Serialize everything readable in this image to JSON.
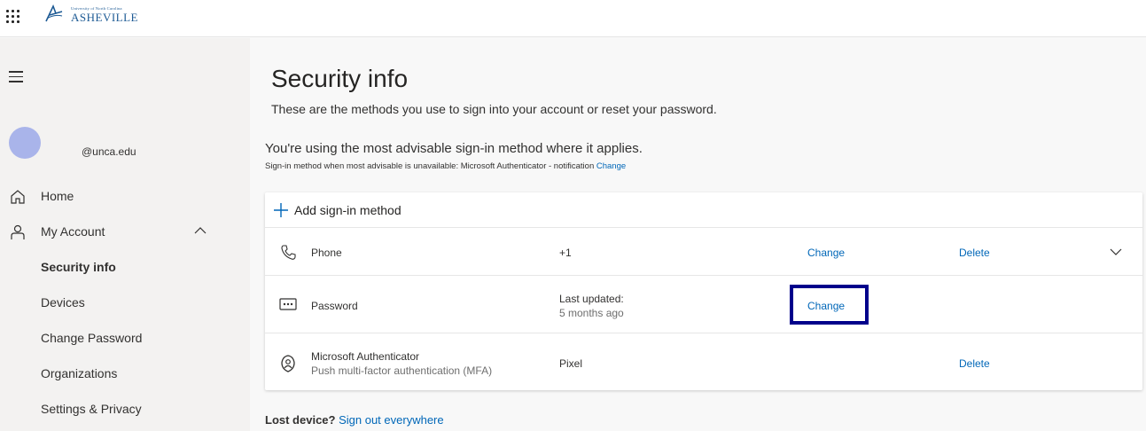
{
  "header": {
    "logo_sub": "University of North Carolina",
    "logo_main": "ASHEVILLE",
    "brand_color": "#1d5a94"
  },
  "sidebar": {
    "email": "@unca.edu",
    "items": [
      {
        "label": "Home",
        "icon": "home-icon"
      },
      {
        "label": "My Account",
        "icon": "person-icon"
      },
      {
        "label": "Security info"
      },
      {
        "label": "Devices"
      },
      {
        "label": "Change Password"
      },
      {
        "label": "Organizations"
      },
      {
        "label": "Settings & Privacy"
      }
    ]
  },
  "main": {
    "title": "Security info",
    "subtitle": "These are the methods you use to sign into your account or reset your password.",
    "advisable": "You're using the most advisable sign-in method where it applies.",
    "fallback_text": "Sign-in method when most advisable is unavailable: Microsoft Authenticator - notification",
    "fallback_link": "Change",
    "add_method": "Add sign-in method",
    "methods": [
      {
        "name": "Phone",
        "detail": "+1",
        "change": "Change",
        "delete": "Delete",
        "icon": "phone-icon"
      },
      {
        "name": "Password",
        "detail": "Last updated:",
        "detail2": "5 months ago",
        "change": "Change",
        "icon": "password-icon"
      },
      {
        "name": "Microsoft Authenticator",
        "name2": "Push multi-factor authentication (MFA)",
        "detail": "Pixel",
        "delete": "Delete",
        "icon": "authenticator-icon"
      }
    ],
    "lost_device_label": "Lost device?",
    "lost_device_link": "Sign out everywhere"
  },
  "colors": {
    "link": "#0067b8",
    "highlight": "#00008b",
    "avatar": "#a9b4ea"
  }
}
